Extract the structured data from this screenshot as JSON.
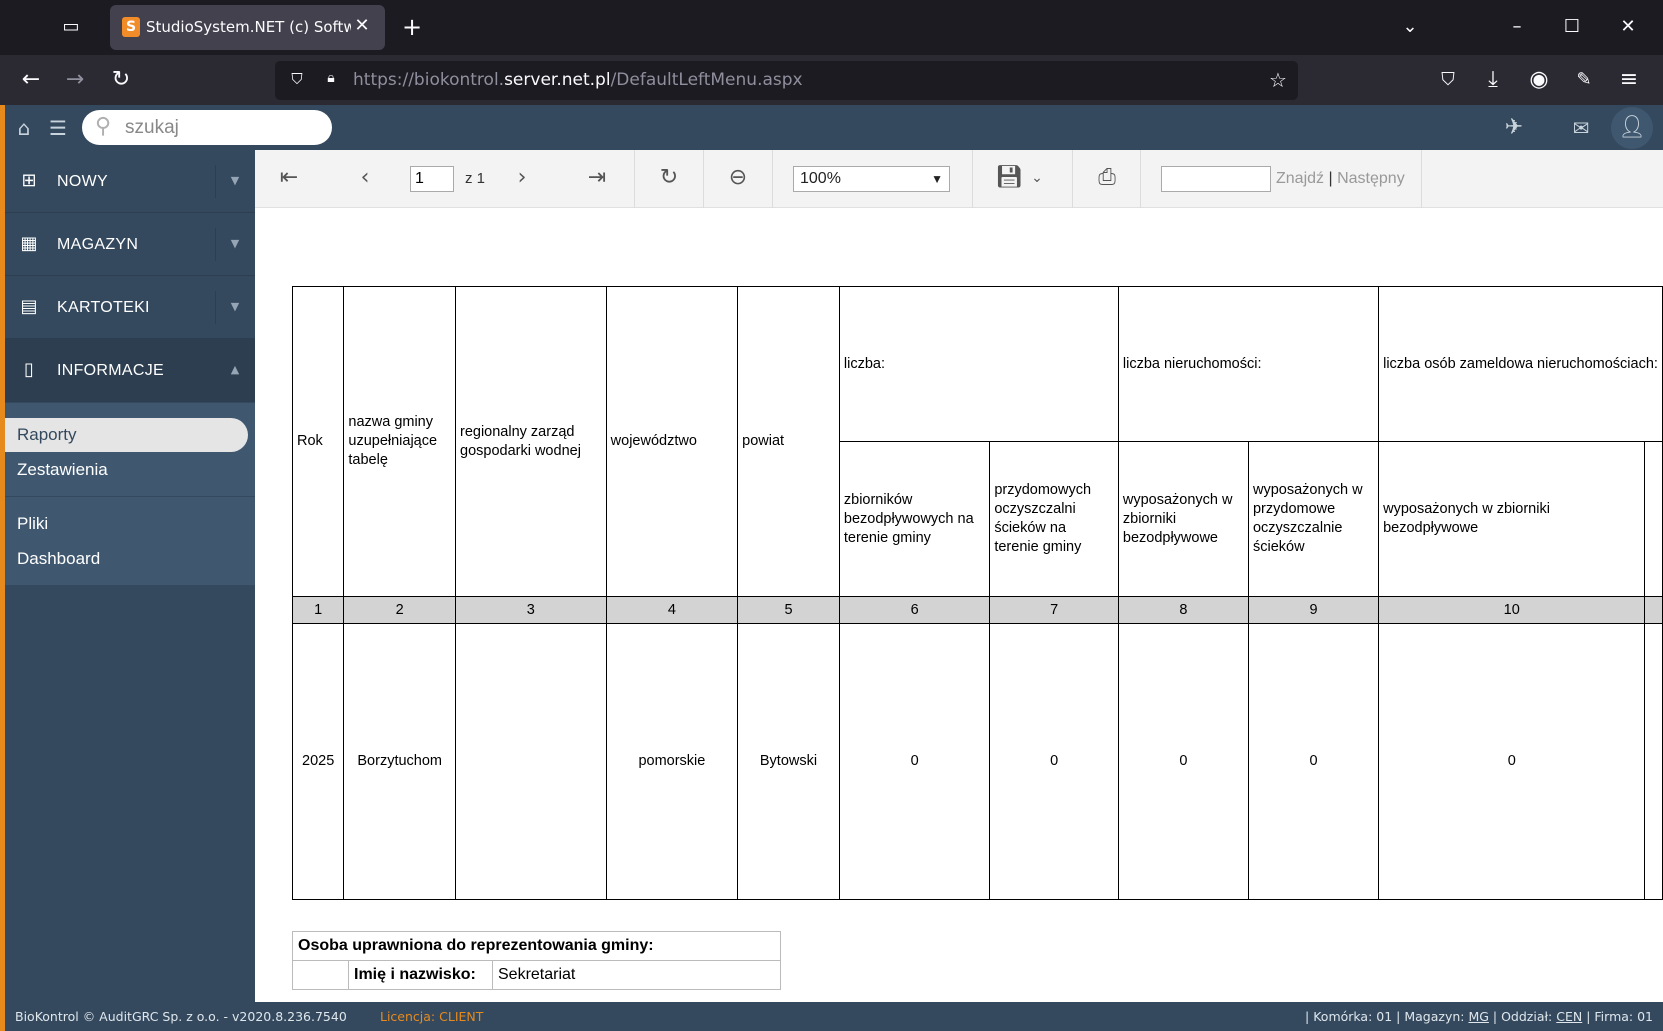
{
  "browser": {
    "tab_title": "StudioSystem.NET (c) SoftwareS",
    "url_prefix": "https://biokontrol.",
    "url_host": "server.net.pl",
    "url_path": "/DefaultLeftMenu.aspx"
  },
  "app": {
    "search_placeholder": "szukaj"
  },
  "sidebar": {
    "menu": [
      {
        "label": "NOWY",
        "icon": "plus-square-icon"
      },
      {
        "label": "MAGAZYN",
        "icon": "pallet-icon"
      },
      {
        "label": "KARTOTEKI",
        "icon": "card-list-icon"
      },
      {
        "label": "INFORMACJE",
        "icon": "document-icon"
      }
    ],
    "submenu": [
      {
        "label": "Raporty",
        "selected": true
      },
      {
        "label": "Zestawienia"
      },
      {
        "label": "Pliki"
      },
      {
        "label": "Dashboard"
      }
    ]
  },
  "toolbar": {
    "page_value": "1",
    "page_of": "z 1",
    "zoom": "100%",
    "find_label": "Znajdź",
    "separator": "|",
    "next_label": "Następny"
  },
  "report": {
    "headers": {
      "rok": "Rok",
      "gmina": "nazwa gminy uzupełniające tabelę",
      "rzgw": "regionalny zarząd gospodarki wodnej",
      "woj": "województwo",
      "powiat": "powiat",
      "liczba": "liczba:",
      "liczba_nier": "liczba nieruchomości:",
      "liczba_osob": "liczba osób zameldowa nieruchomościach:",
      "c6": "zbiorników bezodpływowych na terenie gminy",
      "c7": "przydomowych oczyszczalni ścieków na terenie gminy",
      "c8": "wyposażonych w zbiorniki bezodpływowe",
      "c9": "wyposażonych w przydomowe oczyszczalnie ścieków",
      "c10": "wyposażonych w zbiorniki bezodpływowe"
    },
    "column_numbers": [
      "1",
      "2",
      "3",
      "4",
      "5",
      "6",
      "7",
      "8",
      "9",
      "10"
    ],
    "row": [
      "2025",
      "Borzytuchom",
      "",
      "pomorskie",
      "Bytowski",
      "0",
      "0",
      "0",
      "0",
      "0"
    ],
    "sign_title": "Osoba uprawniona do reprezentowania gminy:",
    "sign_name_label": "Imię i nazwisko:",
    "sign_name_value": "Sekretariat"
  },
  "status": {
    "left": "BioKontrol © AuditGRC Sp. z o.o. - v2020.8.236.7540",
    "license_label": "Licencja:",
    "license_value": "CLIENT",
    "komorka": "| Komórka: 01 | Magazyn: ",
    "magazyn": "MG",
    "oddzial_label": " | Oddział: ",
    "oddzial": "CEN",
    "firma": " | Firma: 01"
  },
  "colors": {
    "sidebar_bg": "#34495e",
    "accent": "#e68a1e",
    "browser_bg": "#1c1b22"
  }
}
